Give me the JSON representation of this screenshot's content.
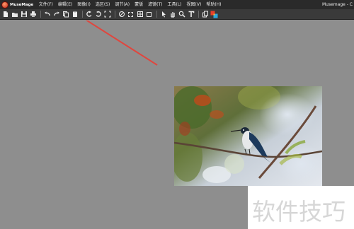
{
  "app": {
    "logo_text": "MuseMage",
    "title": "Musemage - C"
  },
  "menu": [
    "文件(F)",
    "编辑(E)",
    "图像(I)",
    "选区(S)",
    "调节(A)",
    "蒙版",
    "滤镜(T)",
    "工具(L)",
    "视图(V)",
    "帮助(H)"
  ],
  "toolbar": {
    "icons": [
      "new-icon",
      "open-icon",
      "save-icon",
      "print-icon",
      "undo-icon",
      "redo-icon",
      "copy-icon",
      "paste-icon",
      "rotate-left-icon",
      "rotate-right-icon",
      "fit-icon",
      "ellipse-select-icon",
      "rect-select-icon",
      "crosshair-select-icon",
      "dashed-select-icon",
      "pointer-icon",
      "hand-icon",
      "zoom-icon",
      "text-icon",
      "layers-icon",
      "color-swatch-icon"
    ]
  },
  "annotation": {
    "color": "#e0463e"
  },
  "watermark": {
    "text": "软件技巧"
  }
}
